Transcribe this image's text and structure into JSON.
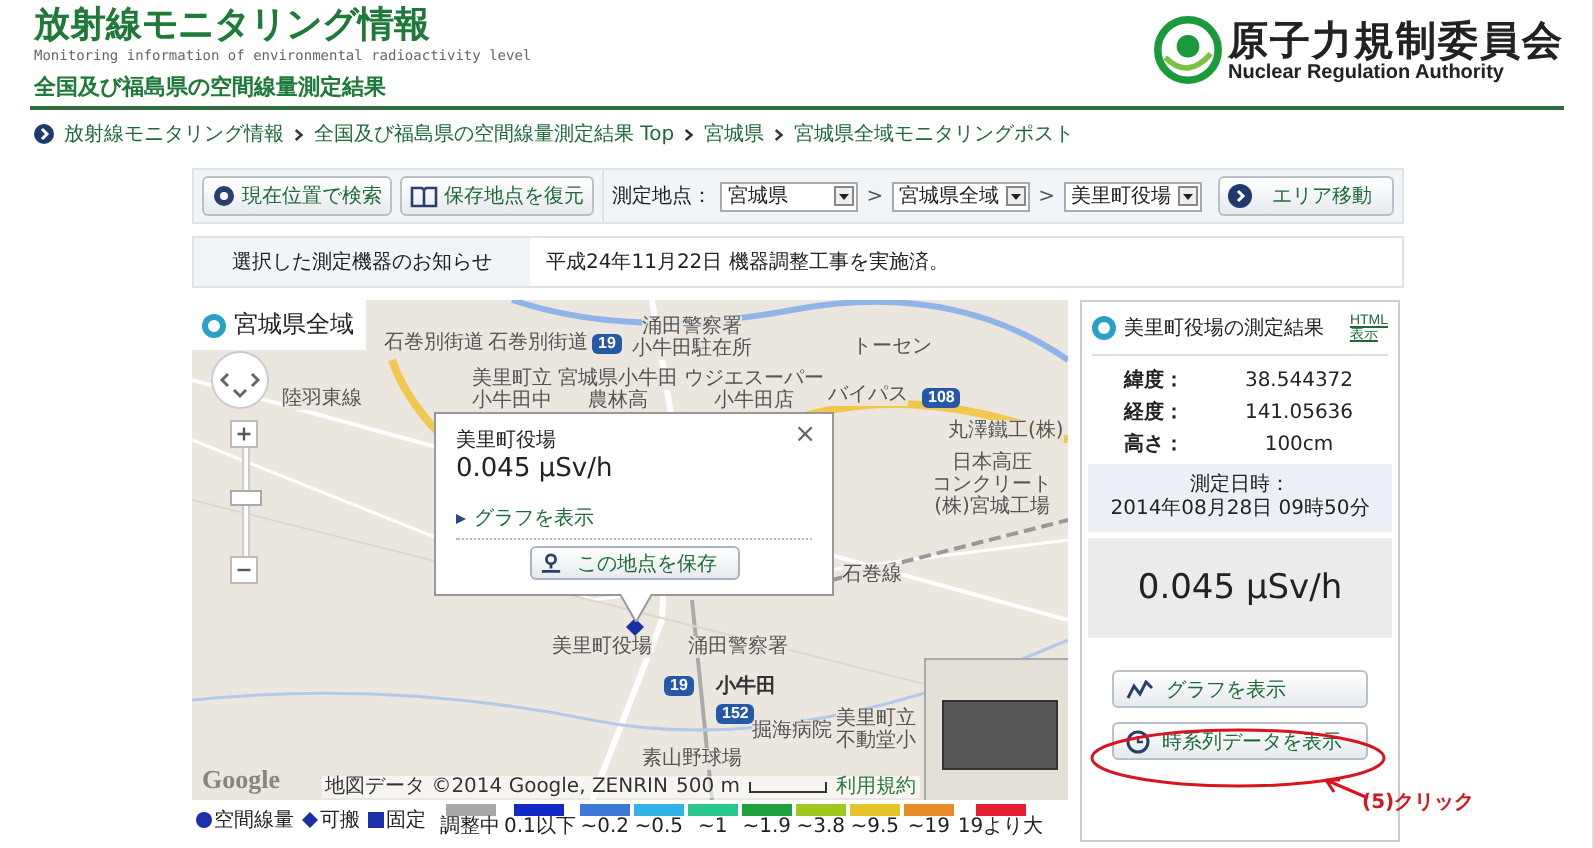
{
  "header": {
    "title": "放射線モニタリング情報",
    "subtitle": "Monitoring information of environmental radioactivity level",
    "section_title": "全国及び福島県の空間線量測定結果",
    "logo_name": "原子力規制委員会",
    "logo_english": "Nuclear Regulation Authority"
  },
  "breadcrumb": [
    {
      "label": "放射線モニタリング情報"
    },
    {
      "label": "全国及び福島県の空間線量測定結果 Top"
    },
    {
      "label": "宮城県"
    },
    {
      "label": "宮城県全域モニタリングポスト"
    }
  ],
  "toolbar": {
    "buttons": [
      {
        "label": "現在位置で検索",
        "kind": "locate"
      },
      {
        "label": "保存地点を復元",
        "kind": "book"
      }
    ],
    "location_label": "測定地点：",
    "selects": [
      {
        "value": "宮城県"
      },
      {
        "prefix": ">",
        "value": "宮城県全域"
      },
      {
        "prefix": ">",
        "value": "美里町役場"
      }
    ],
    "area_button": "エリア移動"
  },
  "notice": {
    "label": "選択した測定機器のお知らせ",
    "text": "平成24年11月22日 機器調整工事を実施済。"
  },
  "map": {
    "title": "宮城県全域",
    "labels": [
      {
        "lines": [
          "石巻別街道"
        ]
      },
      {
        "lines": [
          "石巻別街道"
        ]
      },
      {
        "lines": [
          "涌田警察署",
          "小牛田駐在所"
        ]
      },
      {
        "lines": [
          "美里町立",
          "小牛田中"
        ]
      },
      {
        "lines": [
          "宮城県小牛田",
          "農林高"
        ]
      },
      {
        "lines": [
          "ウジエスーパー",
          "小牛田店"
        ]
      },
      {
        "lines": [
          "トーセン"
        ]
      },
      {
        "lines": [
          "丸澤鐵工(株)"
        ]
      },
      {
        "lines": [
          "日本高圧",
          "コンクリート",
          "(株)宮城工場"
        ]
      },
      {
        "lines": [
          "陸羽東線"
        ]
      },
      {
        "lines": [
          "バイパス"
        ]
      },
      {
        "lines": [
          "石巻線"
        ]
      },
      {
        "lines": [
          "美里町役場"
        ]
      },
      {
        "lines": [
          "涌田警察署"
        ]
      },
      {
        "lines": [
          "小牛田"
        ]
      },
      {
        "lines": [
          "掘海病院"
        ]
      },
      {
        "lines": [
          "素山野球場"
        ]
      },
      {
        "lines": [
          "美里町立",
          "不動堂小"
        ]
      }
    ],
    "road_shields": [
      "19",
      "108",
      "19",
      "152"
    ],
    "popup": {
      "name": "美里町役場",
      "value": "0.045 µSv/h",
      "close": "×",
      "graph_link": "グラフを表示",
      "save_button": "この地点を保存"
    },
    "logo": "Google",
    "attribution": "地図データ ©2014 Google, ZENRIN",
    "scale": "500 m",
    "terms": "利用規約"
  },
  "result": {
    "title": "美里町役場の測定結果",
    "html_link": "HTML\n表示",
    "rows": [
      {
        "label": "緯度：",
        "value": "38.544372"
      },
      {
        "label": "経度：",
        "value": "141.05636"
      },
      {
        "label": "高さ：",
        "value": "100cm"
      }
    ],
    "date_label": "測定日時：",
    "date_value": "2014年08月28日 09時50分",
    "reading": "0.045 µSv/h",
    "buttons": [
      {
        "label": "グラフを表示",
        "kind": "graph"
      },
      {
        "label": "時系列データを表示",
        "kind": "clock"
      }
    ]
  },
  "annotation": {
    "text": "(5)クリック"
  },
  "legend": {
    "symbols": [
      {
        "kind": "circle",
        "label": "空間線量"
      },
      {
        "kind": "diamond",
        "label": "可搬"
      },
      {
        "kind": "square",
        "label": "固定"
      }
    ],
    "scale": [
      {
        "label": "調整中",
        "color": "#a8a8a8"
      },
      {
        "label": "0.1以下",
        "color": "#1428c8"
      },
      {
        "label": "~0.2",
        "color": "#3c78d8"
      },
      {
        "label": "~0.5",
        "color": "#30b4e6"
      },
      {
        "label": "~1",
        "color": "#28c88c"
      },
      {
        "label": "~1.9",
        "color": "#1ea03c"
      },
      {
        "label": "~3.8",
        "color": "#a0c81e"
      },
      {
        "label": "~9.5",
        "color": "#e6c328"
      },
      {
        "label": "~19",
        "color": "#e68c28"
      },
      {
        "label": "19より大",
        "color": "#e61e32"
      }
    ]
  }
}
